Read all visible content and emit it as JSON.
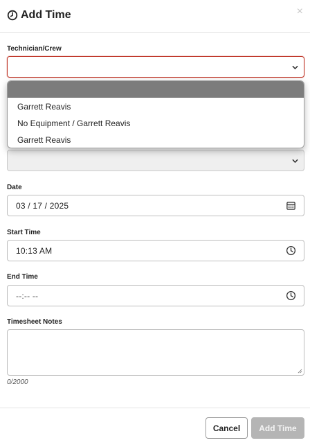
{
  "dialog": {
    "title": "Add Time",
    "close_glyph": "×"
  },
  "form": {
    "technician": {
      "label": "Technician/Crew",
      "value": ""
    },
    "second_select": {
      "value": ""
    },
    "date": {
      "label": "Date",
      "value": "03 / 17 / 2025"
    },
    "start_time": {
      "label": "Start Time",
      "value": "10:13  AM"
    },
    "end_time": {
      "label": "End Time",
      "value": "--:--  --"
    },
    "notes": {
      "label": "Timesheet Notes",
      "value": "",
      "counter": "0/2000"
    }
  },
  "dropdown": {
    "options": [
      "",
      "Garrett Reavis",
      "No Equipment / Garrett Reavis",
      "Garrett Reavis"
    ],
    "highlight_color": "#7c7c7c"
  },
  "footer": {
    "cancel_label": "Cancel",
    "add_label": "Add Time"
  },
  "colors": {
    "error_border": "#c0392b",
    "disabled_button": "#b5b5b5"
  },
  "icons": {
    "title": "clock-icon",
    "close": "close-icon",
    "select": "chevron-down-icon",
    "date": "calendar-icon",
    "time": "clock-icon"
  }
}
